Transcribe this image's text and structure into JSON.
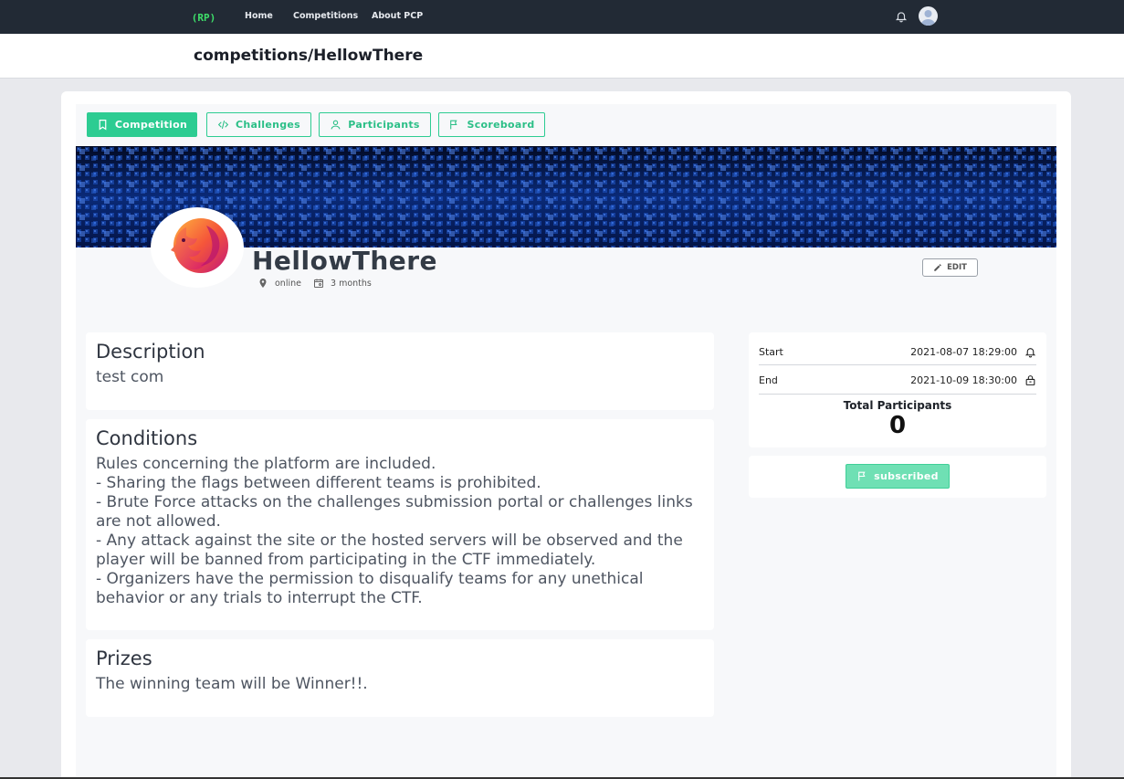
{
  "nav": {
    "logo_text": "(RP)",
    "links": [
      "Home",
      "Competitions",
      "About PCP"
    ]
  },
  "header": {
    "title": "competitions/HellowThere"
  },
  "tabs": [
    {
      "label": "Competition",
      "icon": "bookmark-icon",
      "active": true
    },
    {
      "label": "Challenges",
      "icon": "code-icon",
      "active": false
    },
    {
      "label": "Participants",
      "icon": "user-icon",
      "active": false
    },
    {
      "label": "Scoreboard",
      "icon": "flag-icon",
      "active": false
    }
  ],
  "competition": {
    "name": "HellowThere",
    "location": "online",
    "duration": "3 months",
    "edit_label": "EDIT"
  },
  "sections": {
    "description": {
      "title": "Description",
      "body": "test com"
    },
    "conditions": {
      "title": "Conditions",
      "body": "Rules concerning the platform are included.\n- Sharing the flags between different teams is prohibited.\n- Brute Force attacks on the challenges submission portal or challenges links are not allowed.\n- Any attack against the site or the hosted servers will be observed and the player will be banned from participating in the CTF immediately.\n- Organizers have the permission to disqualify teams for any unethical behavior or any trials to interrupt the CTF."
    },
    "prizes": {
      "title": "Prizes",
      "body": "The winning team will be Winner!!."
    }
  },
  "schedule": {
    "start_label": "Start",
    "start_value": "2021-08-07 18:29:00",
    "end_label": "End",
    "end_value": "2021-10-09 18:30:00",
    "participants_label": "Total Participants",
    "participants_value": "0"
  },
  "subscribe": {
    "label": "subscribed"
  },
  "colors": {
    "accent": "#2dcc92",
    "navbar": "#222a35",
    "subscribed": "#6fe0b4"
  }
}
